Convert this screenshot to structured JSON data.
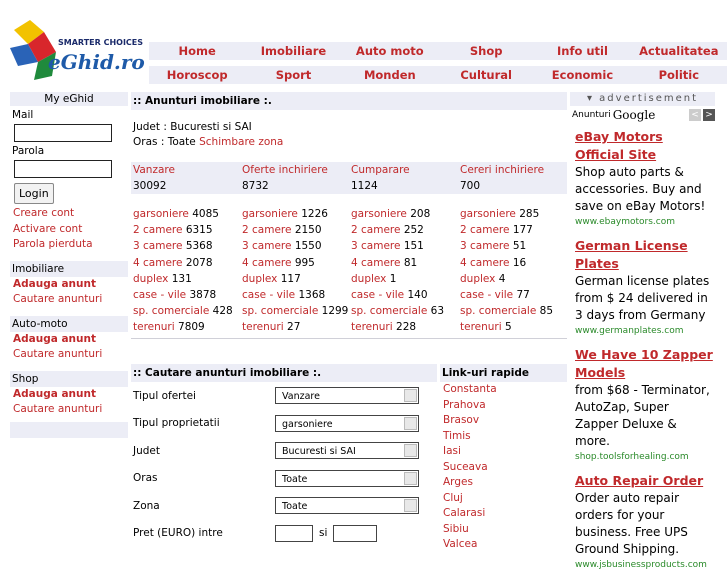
{
  "logo": {
    "tagline": "SMARTER CHOICES",
    "name": "eGhid.ro"
  },
  "nav_row1": [
    "Home",
    "Imobiliare",
    "Auto moto",
    "Shop",
    "Info util",
    "Actualitatea"
  ],
  "nav_row2": [
    "Horoscop",
    "Sport",
    "Monden",
    "Cultural",
    "Economic",
    "Politic"
  ],
  "left": {
    "title": "My eGhid",
    "mail_label": "Mail",
    "password_label": "Parola",
    "login_button": "Login",
    "account_links": [
      "Creare cont",
      "Activare cont",
      "Parola pierduta"
    ],
    "sections": [
      {
        "title": "Imobiliare",
        "add": "Adauga anunt",
        "search": "Cautare anunturi"
      },
      {
        "title": "Auto-moto",
        "add": "Adauga anunt",
        "search": "Cautare anunturi"
      },
      {
        "title": "Shop",
        "add": "Adauga anunt",
        "search": "Cautare anunturi"
      }
    ]
  },
  "center": {
    "title": ":: Anunturi imobiliare :.",
    "county": "Judet : Bucuresti si SAI",
    "city_label": "Oras : Toate",
    "change_zone": "Schimbare zona",
    "stats": [
      {
        "label": "Vanzare",
        "count": "30092"
      },
      {
        "label": "Oferte inchiriere",
        "count": "8732"
      },
      {
        "label": "Cumparare",
        "count": "1124"
      },
      {
        "label": "Cereri inchiriere",
        "count": "700"
      }
    ],
    "types": [
      [
        {
          "name": "garsoniere",
          "count": "4085"
        },
        {
          "name": "garsoniere",
          "count": "1226"
        },
        {
          "name": "garsoniere",
          "count": "208"
        },
        {
          "name": "garsoniere",
          "count": "285"
        }
      ],
      [
        {
          "name": "2 camere",
          "count": "6315"
        },
        {
          "name": "2 camere",
          "count": "2150"
        },
        {
          "name": "2 camere",
          "count": "252"
        },
        {
          "name": "2 camere",
          "count": "177"
        }
      ],
      [
        {
          "name": "3 camere",
          "count": "5368"
        },
        {
          "name": "3 camere",
          "count": "1550"
        },
        {
          "name": "3 camere",
          "count": "151"
        },
        {
          "name": "3 camere",
          "count": "51"
        }
      ],
      [
        {
          "name": "4 camere",
          "count": "2078"
        },
        {
          "name": "4 camere",
          "count": "995"
        },
        {
          "name": "4 camere",
          "count": "81"
        },
        {
          "name": "4 camere",
          "count": "16"
        }
      ],
      [
        {
          "name": "duplex",
          "count": "131"
        },
        {
          "name": "duplex",
          "count": "117"
        },
        {
          "name": "duplex",
          "count": "1"
        },
        {
          "name": "duplex",
          "count": "4"
        }
      ],
      [
        {
          "name": "case - vile",
          "count": "3878"
        },
        {
          "name": "case - vile",
          "count": "1368"
        },
        {
          "name": "case - vile",
          "count": "140"
        },
        {
          "name": "case - vile",
          "count": "77"
        }
      ],
      [
        {
          "name": "sp. comerciale",
          "count": "428"
        },
        {
          "name": "sp. comerciale",
          "count": "1299"
        },
        {
          "name": "sp. comerciale",
          "count": "63"
        },
        {
          "name": "sp. comerciale",
          "count": "85"
        }
      ],
      [
        {
          "name": "terenuri",
          "count": "7809"
        },
        {
          "name": "terenuri",
          "count": "27"
        },
        {
          "name": "terenuri",
          "count": "228"
        },
        {
          "name": "terenuri",
          "count": "5"
        }
      ]
    ]
  },
  "search": {
    "title": ":: Cautare anunturi imobiliare :.",
    "fields": [
      {
        "label": "Tipul ofertei",
        "value": "Vanzare"
      },
      {
        "label": "Tipul proprietatii",
        "value": "garsoniere"
      },
      {
        "label": "Judet",
        "value": "Bucuresti si SAI"
      },
      {
        "label": "Oras",
        "value": "Toate"
      },
      {
        "label": "Zona",
        "value": "Toate"
      }
    ],
    "price_label": "Pret (EURO) intre",
    "price_and": "si"
  },
  "quick_links": {
    "title": "Link-uri rapide",
    "items": [
      "Constanta",
      "Prahova",
      "Brasov",
      "Timis",
      "Iasi",
      "Suceava",
      "Arges",
      "Cluj",
      "Calarasi",
      "Sibiu",
      "Valcea"
    ]
  },
  "ads": {
    "header": "advertisement",
    "google_label": "Anunturi",
    "google_brand": "Google",
    "items": [
      {
        "title": "eBay Motors Official Site",
        "body": "Shop auto parts & accessories. Buy and save on eBay Motors!",
        "url": "www.ebaymotors.com"
      },
      {
        "title": "German License Plates",
        "body": "German license plates from $ 24 delivered in 3 days from Germany",
        "url": "www.germanplates.com"
      },
      {
        "title": "We Have 10 Zapper Models",
        "body": "from $68 - Terminator, AutoZap, Super Zapper Deluxe & more.",
        "url": "shop.toolsforhealing.com"
      },
      {
        "title": "Auto Repair Order",
        "body": "Order auto repair orders for your business. Free UPS Ground Shipping.",
        "url": "www.jsbusinessproducts.com"
      }
    ]
  },
  "colors": {
    "accent": "#c0292b",
    "band": "#ecedf6",
    "ad_url": "#2a8a2a"
  }
}
